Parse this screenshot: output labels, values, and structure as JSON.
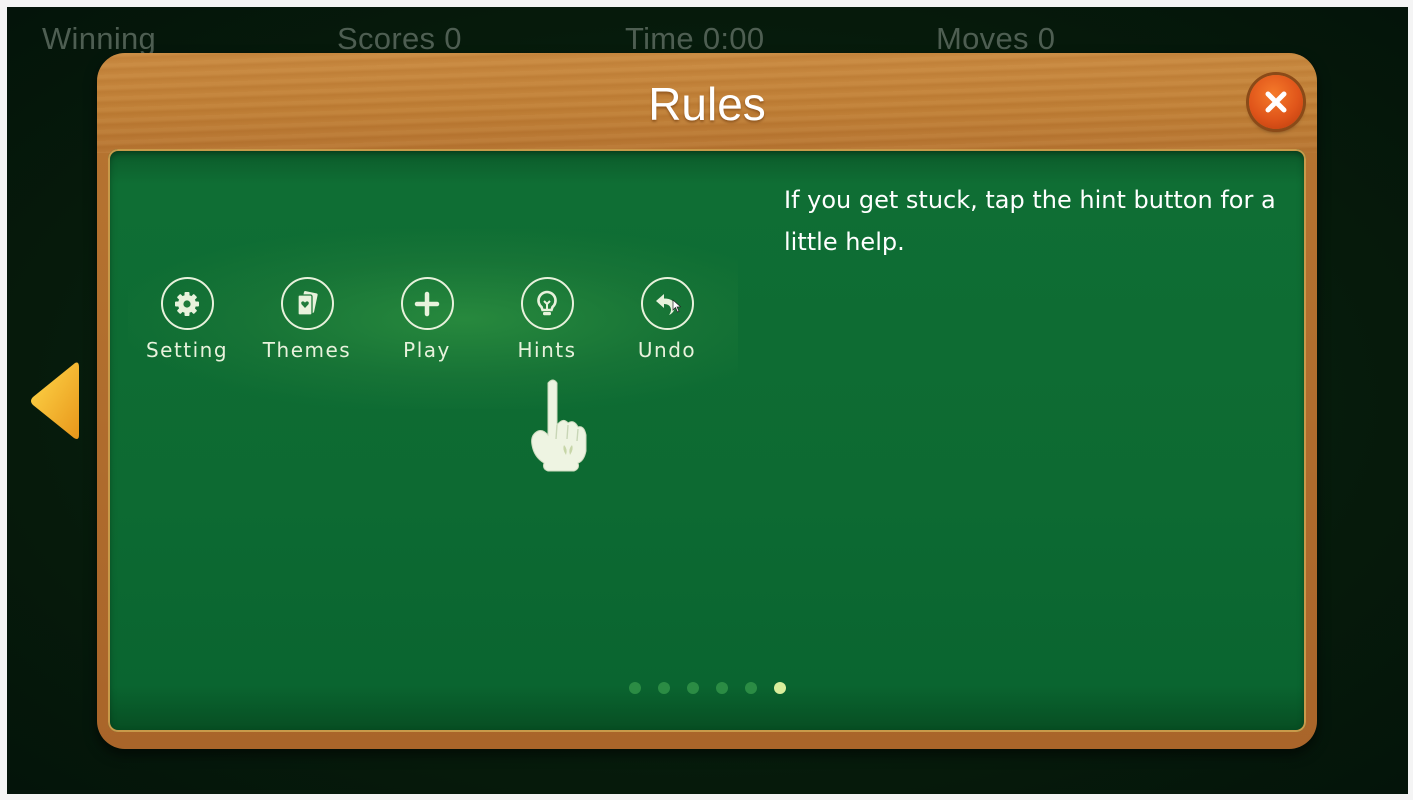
{
  "hud": {
    "winning_label": "Winning",
    "scores": "Scores  0",
    "time": "Time  0:00",
    "moves": "Moves  0"
  },
  "dialog": {
    "title": "Rules",
    "close_icon": "close-x-icon",
    "colors": {
      "wood": "#b57330",
      "board": "#0d6a32",
      "close": "#e0551a",
      "arrow": "#f0b820"
    }
  },
  "tutorial": {
    "toolbar": [
      {
        "label": "Setting",
        "icon": "gear-icon"
      },
      {
        "label": "Themes",
        "icon": "cards-icon"
      },
      {
        "label": "Play",
        "icon": "plus-icon"
      },
      {
        "label": "Hints",
        "icon": "lightbulb-icon"
      },
      {
        "label": "Undo",
        "icon": "undo-icon"
      }
    ],
    "highlighted": "Hints",
    "description": "If you get stuck, tap the hint button for a little help."
  },
  "pagination": {
    "total": 6,
    "current": 6
  },
  "nav": {
    "prev_icon": "left-arrow-icon"
  }
}
